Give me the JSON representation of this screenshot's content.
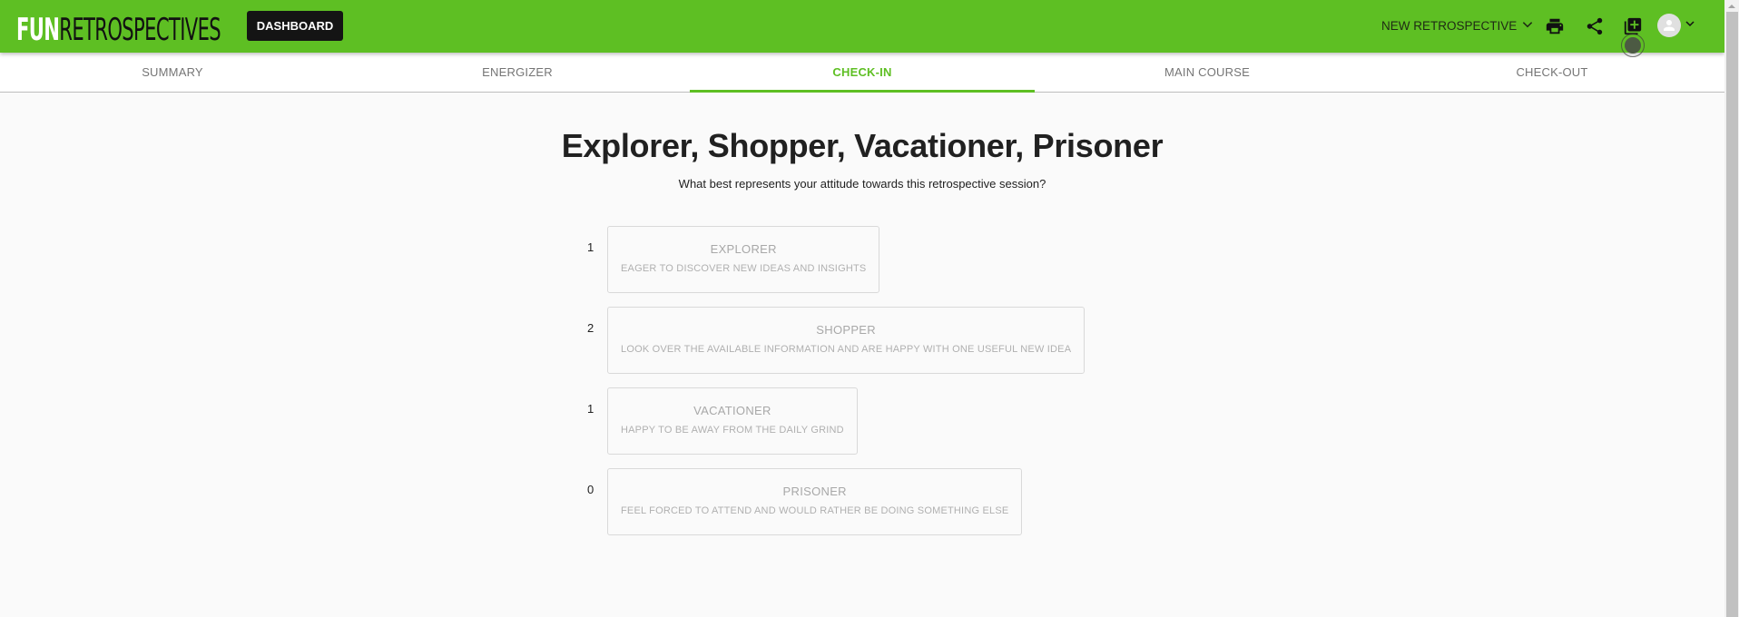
{
  "header": {
    "logo": {
      "part1": "FUN",
      "part2": "RETROSPECTIVES"
    },
    "dashboard_label": "DASHBOARD",
    "new_retro_label": "NEW RETROSPECTIVE",
    "icons": [
      "print-icon",
      "share-icon",
      "library-add-icon",
      "account-circle-icon",
      "chevron-down-icon"
    ]
  },
  "tabs": [
    {
      "label": "SUMMARY",
      "active": false
    },
    {
      "label": "ENERGIZER",
      "active": false
    },
    {
      "label": "CHECK-IN",
      "active": true
    },
    {
      "label": "MAIN COURSE",
      "active": false
    },
    {
      "label": "CHECK-OUT",
      "active": false
    }
  ],
  "main": {
    "title": "Explorer, Shopper, Vacationer, Prisoner",
    "subtitle": "What best represents your attitude towards this retrospective session?",
    "options": [
      {
        "count": "1",
        "name": "EXPLORER",
        "desc": "EAGER TO DISCOVER NEW IDEAS AND INSIGHTS"
      },
      {
        "count": "2",
        "name": "SHOPPER",
        "desc": "LOOK OVER THE AVAILABLE INFORMATION AND ARE HAPPY WITH ONE USEFUL NEW IDEA"
      },
      {
        "count": "1",
        "name": "VACATIONER",
        "desc": "HAPPY TO BE AWAY FROM THE DAILY GRIND"
      },
      {
        "count": "0",
        "name": "PRISONER",
        "desc": "FEEL FORCED TO ATTEND AND WOULD RATHER BE DOING SOMETHING ELSE"
      }
    ]
  },
  "colors": {
    "brand_green": "#5ebf23",
    "dark_button": "#141414",
    "background": "#fafafa"
  }
}
